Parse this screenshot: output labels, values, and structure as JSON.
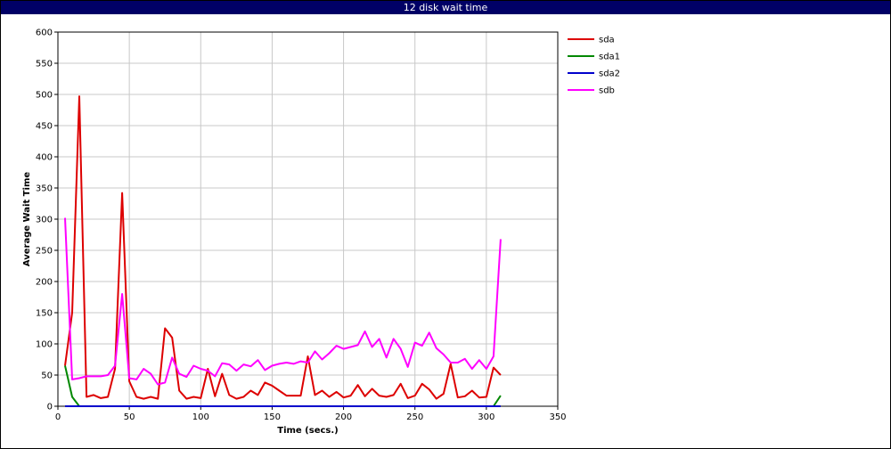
{
  "window": {
    "title": "12 disk wait time"
  },
  "chart_data": {
    "type": "line",
    "title": "12 disk wait time",
    "xlabel": "Time (secs.)",
    "ylabel": "Average Wait Time",
    "xlim": [
      0,
      350
    ],
    "ylim": [
      0,
      600
    ],
    "xticks": [
      0,
      50,
      100,
      150,
      200,
      250,
      300,
      350
    ],
    "yticks": [
      0,
      50,
      100,
      150,
      200,
      250,
      300,
      350,
      400,
      450,
      500,
      550,
      600
    ],
    "grid": true,
    "legend_position": "right",
    "series": [
      {
        "name": "sda",
        "color": "#dd0000",
        "x": [
          5,
          10,
          15,
          20,
          25,
          30,
          35,
          40,
          45,
          50,
          55,
          60,
          65,
          70,
          75,
          80,
          85,
          90,
          95,
          100,
          105,
          110,
          115,
          120,
          125,
          130,
          135,
          140,
          145,
          150,
          155,
          160,
          165,
          170,
          175,
          180,
          185,
          190,
          195,
          200,
          205,
          210,
          215,
          220,
          225,
          230,
          235,
          240,
          245,
          250,
          255,
          260,
          265,
          270,
          275,
          280,
          285,
          290,
          295,
          300,
          305,
          310
        ],
        "values": [
          65,
          150,
          497,
          15,
          18,
          13,
          15,
          60,
          342,
          40,
          15,
          12,
          15,
          12,
          125,
          110,
          25,
          12,
          15,
          13,
          60,
          16,
          52,
          18,
          12,
          15,
          25,
          18,
          38,
          33,
          25,
          17,
          17,
          17,
          80,
          18,
          25,
          15,
          23,
          14,
          17,
          34,
          16,
          28,
          17,
          15,
          18,
          36,
          13,
          17,
          36,
          27,
          12,
          20,
          68,
          14,
          16,
          25,
          14,
          15,
          62,
          50
        ]
      },
      {
        "name": "sda1",
        "color": "#008800",
        "x": [
          5,
          10,
          15,
          20,
          25,
          30,
          35,
          40,
          45,
          50,
          55,
          60,
          65,
          70,
          75,
          80,
          85,
          90,
          95,
          100,
          105,
          110,
          115,
          120,
          125,
          130,
          135,
          140,
          145,
          150,
          155,
          160,
          165,
          170,
          175,
          180,
          185,
          190,
          195,
          200,
          205,
          210,
          215,
          220,
          225,
          230,
          235,
          240,
          245,
          250,
          255,
          260,
          265,
          270,
          275,
          280,
          285,
          290,
          295,
          300,
          305,
          310
        ],
        "values": [
          65,
          15,
          0,
          0,
          0,
          0,
          0,
          0,
          0,
          0,
          0,
          0,
          0,
          0,
          0,
          0,
          0,
          0,
          0,
          0,
          0,
          0,
          0,
          0,
          0,
          0,
          0,
          0,
          0,
          0,
          0,
          0,
          0,
          0,
          0,
          0,
          0,
          0,
          0,
          0,
          0,
          0,
          0,
          0,
          0,
          0,
          0,
          0,
          0,
          0,
          0,
          0,
          0,
          0,
          0,
          0,
          0,
          0,
          0,
          0,
          0,
          17
        ]
      },
      {
        "name": "sda2",
        "color": "#0000cc",
        "x": [
          5,
          310
        ],
        "values": [
          0,
          0
        ]
      },
      {
        "name": "sdb",
        "color": "#ff00ff",
        "x": [
          5,
          10,
          15,
          20,
          25,
          30,
          35,
          40,
          45,
          50,
          55,
          60,
          65,
          70,
          75,
          80,
          85,
          90,
          95,
          100,
          105,
          110,
          115,
          120,
          125,
          130,
          135,
          140,
          145,
          150,
          155,
          160,
          165,
          170,
          175,
          180,
          185,
          190,
          195,
          200,
          205,
          210,
          215,
          220,
          225,
          230,
          235,
          240,
          245,
          250,
          255,
          260,
          265,
          270,
          275,
          280,
          285,
          290,
          295,
          300,
          305,
          310
        ],
        "values": [
          302,
          43,
          45,
          48,
          48,
          48,
          50,
          65,
          180,
          45,
          43,
          60,
          52,
          35,
          38,
          78,
          52,
          47,
          65,
          60,
          57,
          48,
          69,
          67,
          57,
          67,
          64,
          74,
          58,
          65,
          68,
          70,
          68,
          72,
          70,
          88,
          75,
          85,
          97,
          92,
          95,
          98,
          120,
          95,
          108,
          78,
          108,
          92,
          63,
          102,
          97,
          118,
          93,
          83,
          70,
          70,
          76,
          60,
          74,
          60,
          80,
          268
        ]
      }
    ]
  }
}
